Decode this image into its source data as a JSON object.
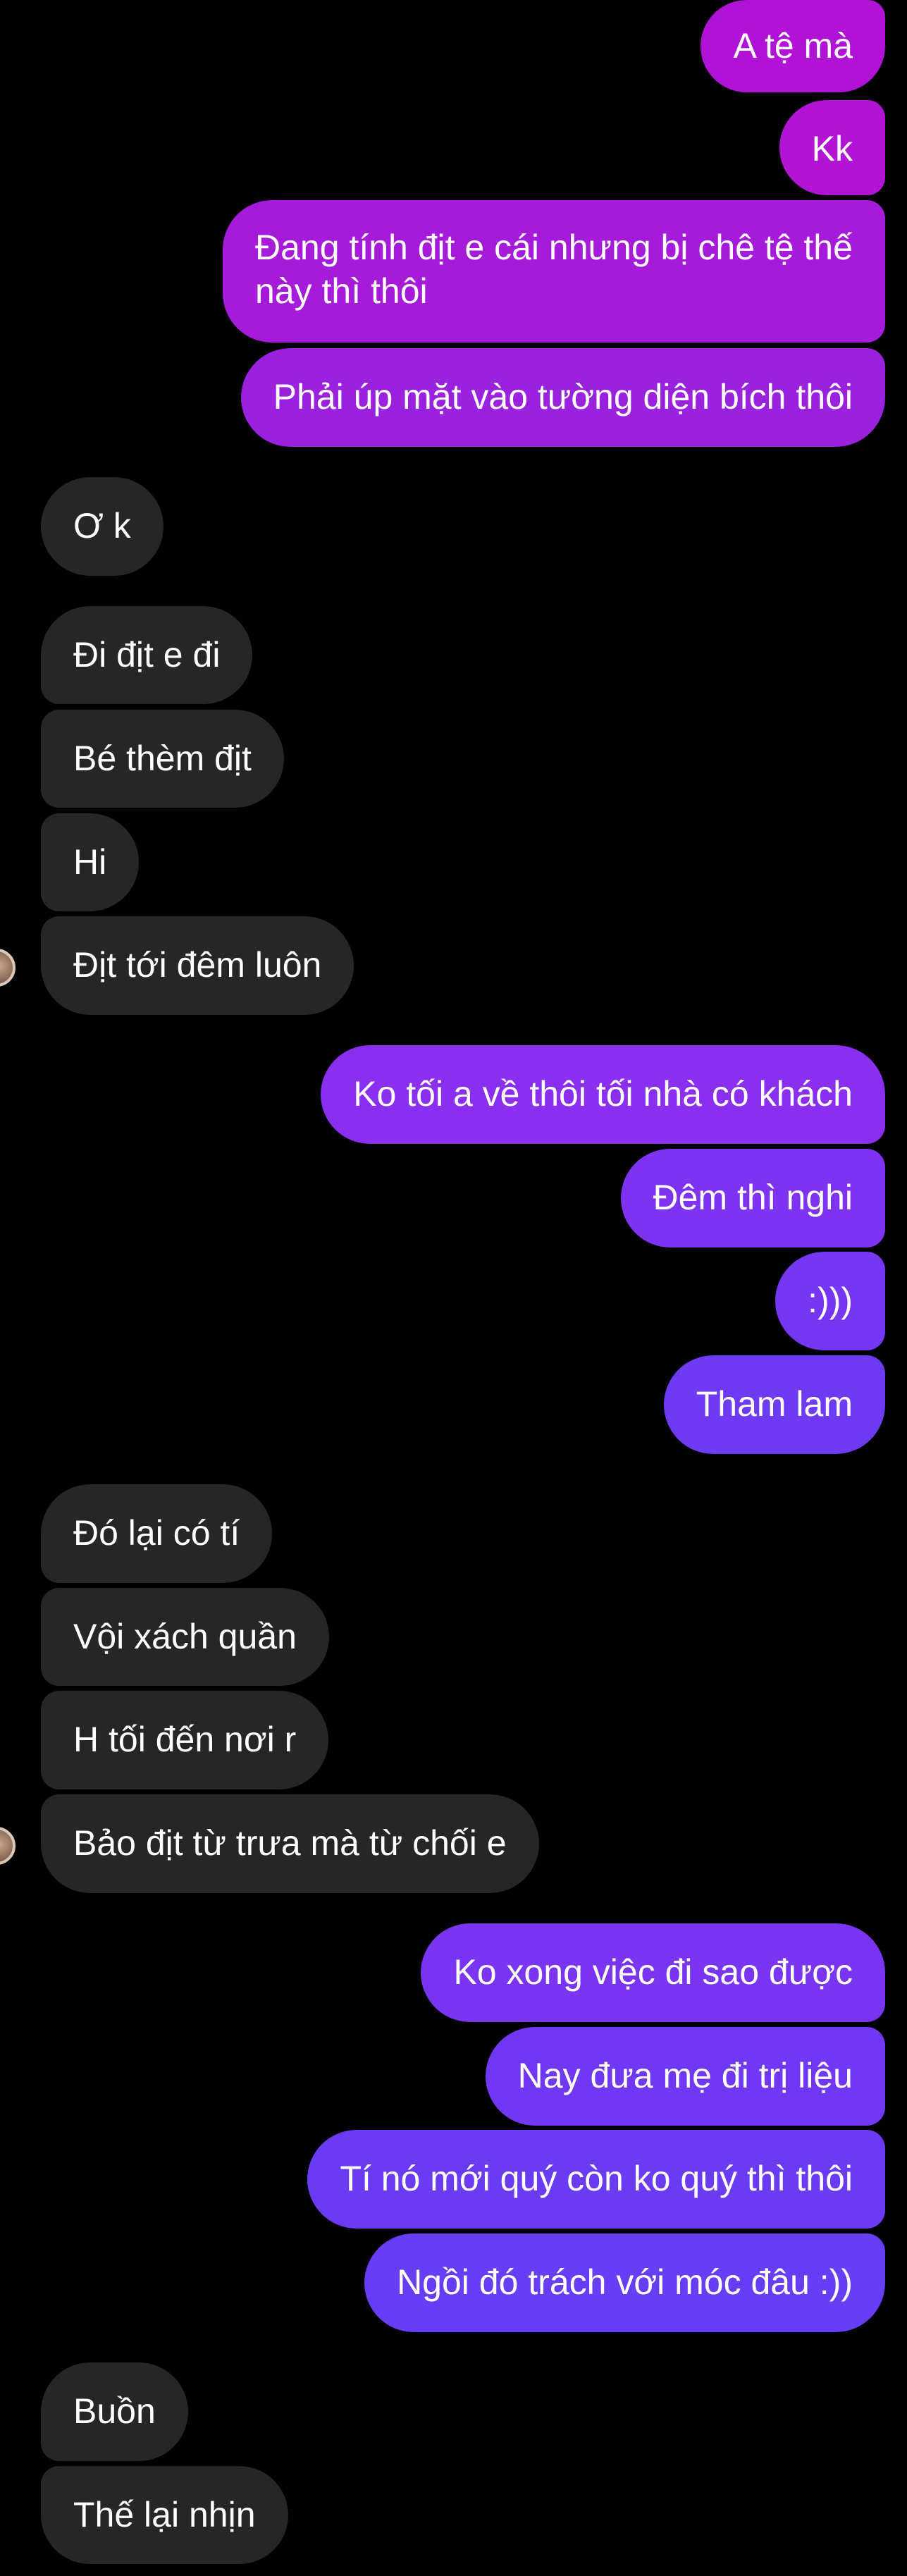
{
  "colors": {
    "background": "#000000",
    "received_bubble": "#262626",
    "sent_magenta": "#b012d6",
    "sent_purple_mid": "#8a2ef0",
    "sent_purple": "#6a3cf4"
  },
  "messages": [
    {
      "side": "sent",
      "text": "A tệ mà"
    },
    {
      "side": "sent",
      "text": "Kk"
    },
    {
      "side": "sent",
      "text": "Đang tính địt e cái nhưng bị chê tệ thế này thì thôi"
    },
    {
      "side": "sent",
      "text": "Phải úp mặt vào tường diện bích thôi"
    },
    {
      "side": "received",
      "text": "Ơ k"
    },
    {
      "side": "received",
      "text": "Đi địt e đi"
    },
    {
      "side": "received",
      "text": "Bé thèm địt"
    },
    {
      "side": "received",
      "text": "Hi"
    },
    {
      "side": "received",
      "text": "Địt tới đêm luôn"
    },
    {
      "side": "sent",
      "text": "Ko tối a về thôi tối nhà có khách"
    },
    {
      "side": "sent",
      "text": "Đêm thì nghi"
    },
    {
      "side": "sent",
      "text": ":)))"
    },
    {
      "side": "sent",
      "text": "Tham lam"
    },
    {
      "side": "received",
      "text": "Đó lại có tí"
    },
    {
      "side": "received",
      "text": "Vội xách quần"
    },
    {
      "side": "received",
      "text": "H tối đến nơi r"
    },
    {
      "side": "received",
      "text": "Bảo địt từ trưa mà từ chối e"
    },
    {
      "side": "sent",
      "text": "Ko xong việc đi sao được"
    },
    {
      "side": "sent",
      "text": "Nay đưa mẹ đi trị liệu"
    },
    {
      "side": "sent",
      "text": "Tí nó mới quý còn ko quý thì thôi"
    },
    {
      "side": "sent",
      "text": "Ngồi đó trách với móc đâu :))"
    },
    {
      "side": "received",
      "text": "Buồn"
    },
    {
      "side": "received",
      "text": "Thế lại nhịn"
    }
  ]
}
